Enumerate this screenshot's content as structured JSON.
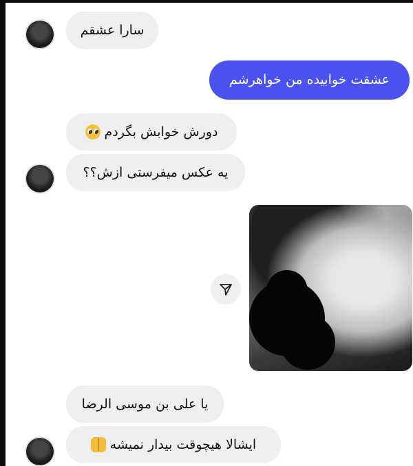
{
  "messages": [
    {
      "text": "سارا عشقم"
    },
    {
      "text": "عشقت خوابیده من خواهرشم"
    },
    {
      "text": "دورش خوابش بگردم"
    },
    {
      "text": "یه عکس میفرستی ازش؟؟"
    },
    {
      "text": "یا علی بن موسی الرضا"
    },
    {
      "text": "ایشالا هیچوقت بیدار نمیشه"
    }
  ],
  "icons": {
    "avatar": "avatar-photo",
    "share": "send-icon",
    "emoji_pleading": "pleading-face-emoji",
    "emoji_hands": "palms-up-together-emoji"
  },
  "colors": {
    "sent_bubble": "#4a53f0",
    "received_bubble": "#efefef"
  }
}
